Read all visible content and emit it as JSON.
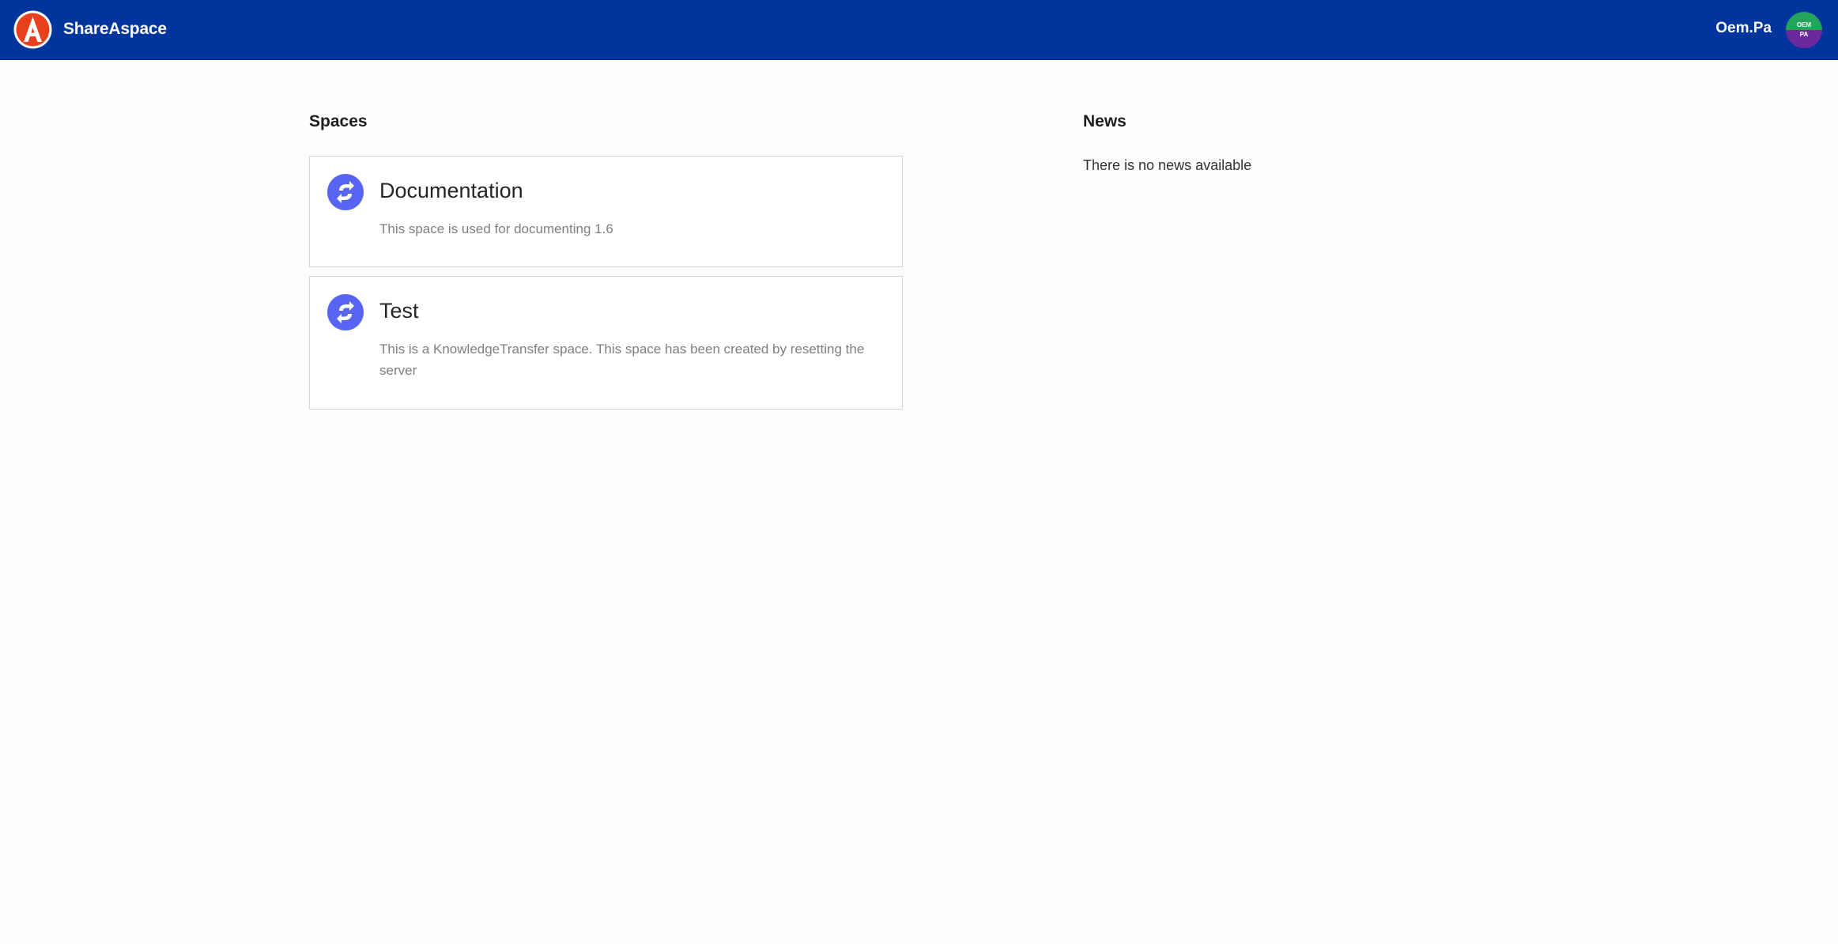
{
  "header": {
    "brand": "ShareAspace",
    "username": "Oem.Pa",
    "avatar": {
      "top_text": "OEM",
      "bottom_text": "PA",
      "top_color": "#22a45d",
      "bottom_color": "#6a2a9e"
    },
    "background_color": "#00359e",
    "logo_icon": "shareaspace-logo-icon"
  },
  "spaces": {
    "title": "Spaces",
    "items": [
      {
        "title": "Documentation",
        "description": "This space is used for documenting 1.6",
        "icon": "space-sync-icon"
      },
      {
        "title": "Test",
        "description": "This is a KnowledgeTransfer space. This space has been created by resetting the server",
        "icon": "space-sync-icon"
      }
    ],
    "icon_color": "#5865f2"
  },
  "news": {
    "title": "News",
    "empty_text": "There is no news available"
  }
}
